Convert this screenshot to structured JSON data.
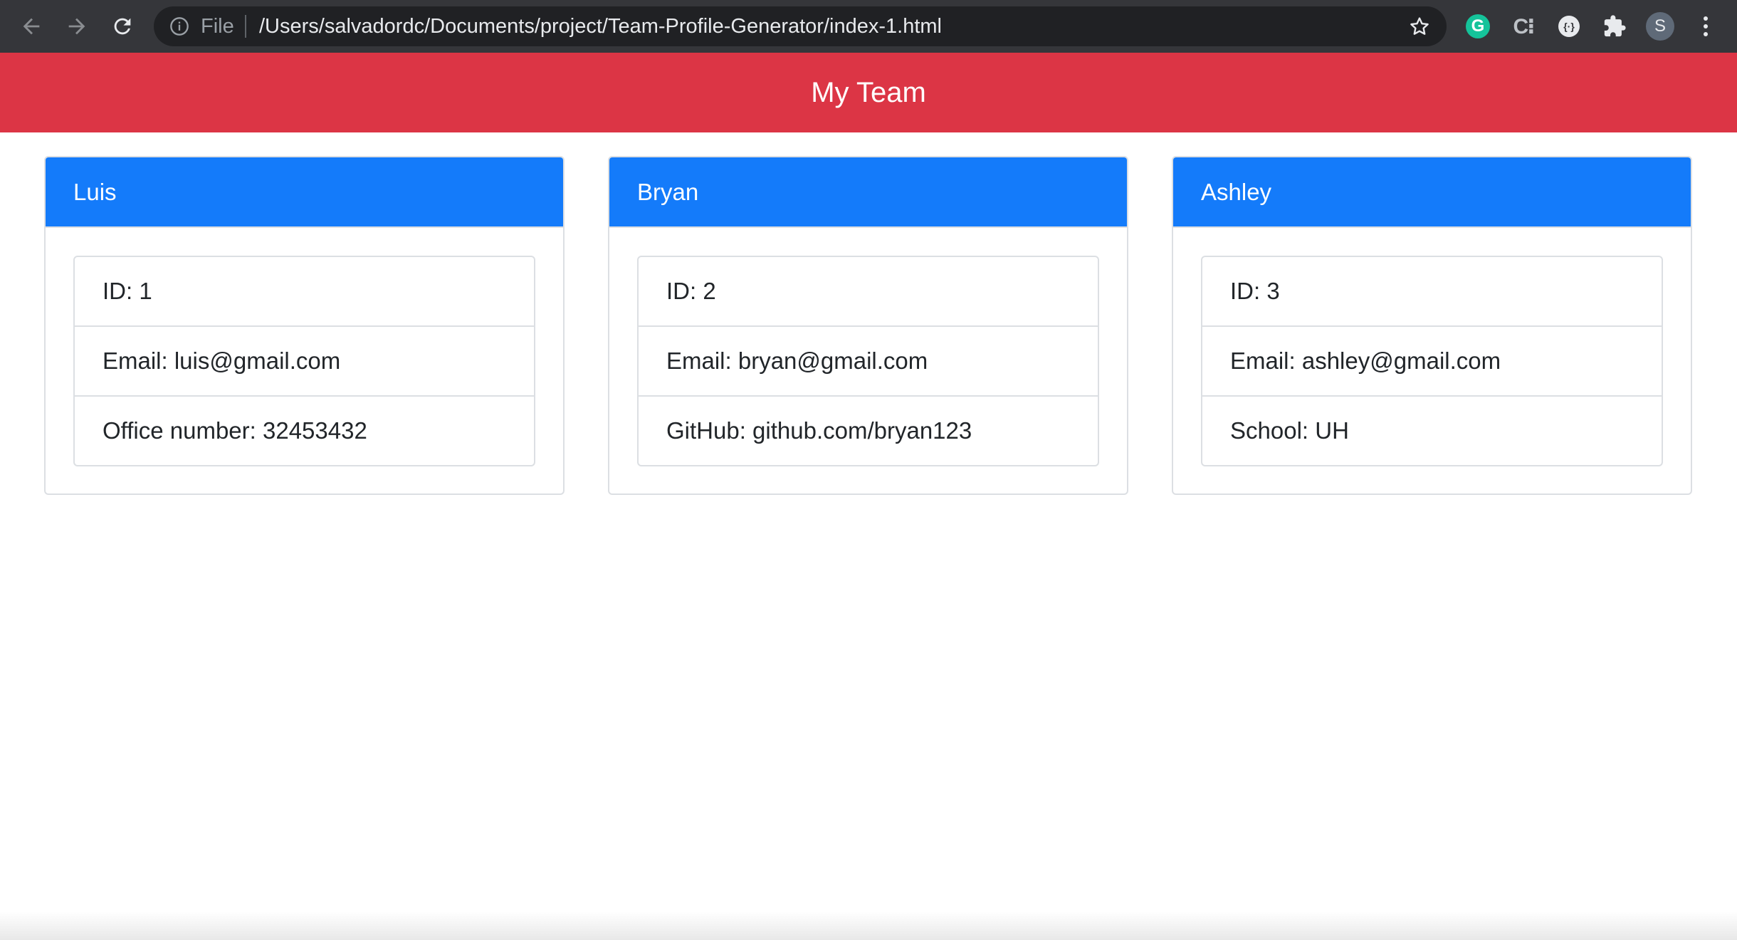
{
  "browser": {
    "scheme_label": "File",
    "url": "/Users/salvadordc/Documents/project/Team-Profile-Generator/index-1.html",
    "profile_initial": "S",
    "grammarly_letter": "G",
    "icons": [
      "back-icon",
      "forward-icon",
      "reload-icon",
      "info-icon",
      "star-icon",
      "grammarly-icon",
      "extension-c-icon",
      "extension-circle-icon",
      "puzzle-icon",
      "menu-icon"
    ]
  },
  "header": {
    "title": "My Team",
    "color": "#dc3545"
  },
  "theme": {
    "card_header_color": "#147bfa"
  },
  "team": [
    {
      "name": "Luis",
      "id": "ID: 1",
      "email": "Email: luis@gmail.com",
      "extra": "Office number: 32453432"
    },
    {
      "name": "Bryan",
      "id": "ID: 2",
      "email": "Email: bryan@gmail.com",
      "extra": "GitHub: github.com/bryan123"
    },
    {
      "name": "Ashley",
      "id": "ID: 3",
      "email": "Email: ashley@gmail.com",
      "extra": "School: UH"
    }
  ]
}
